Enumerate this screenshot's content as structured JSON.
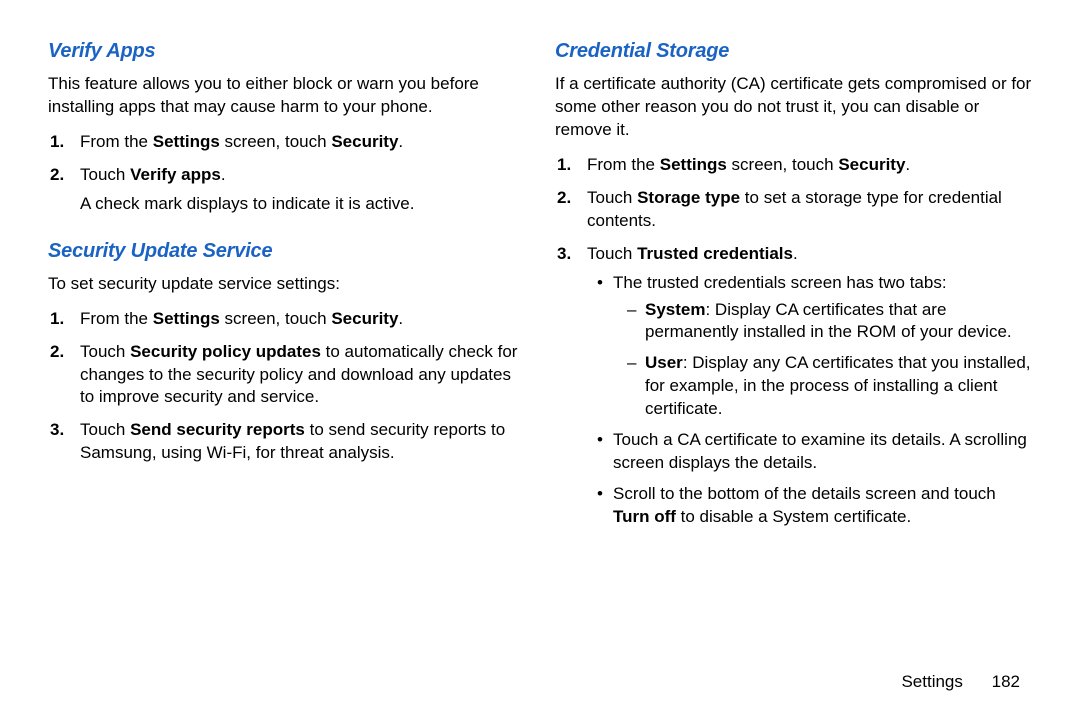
{
  "left": {
    "verify_apps": {
      "heading": "Verify Apps",
      "intro": "This feature allows you to either block or warn you before installing apps that may cause harm to your phone.",
      "step1_pre": "From the ",
      "step1_b1": "Settings",
      "step1_mid": " screen, touch ",
      "step1_b2": "Security",
      "step1_post": ".",
      "step2_pre": "Touch ",
      "step2_b1": "Verify apps",
      "step2_post": ".",
      "step2_note": "A check mark displays to indicate it is active."
    },
    "sus": {
      "heading": "Security Update Service",
      "intro": "To set security update service settings:",
      "step1_pre": "From the ",
      "step1_b1": "Settings",
      "step1_mid": " screen, touch ",
      "step1_b2": "Security",
      "step1_post": ".",
      "step2_pre": "Touch ",
      "step2_b1": "Security policy updates",
      "step2_post": " to automatically check for changes to the security policy and download any updates to improve security and service.",
      "step3_pre": "Touch ",
      "step3_b1": "Send security reports",
      "step3_post": " to send security reports to Samsung, using Wi-Fi, for threat analysis."
    }
  },
  "right": {
    "cred": {
      "heading": "Credential Storage",
      "intro": "If a certificate authority (CA) certificate gets compromised or for some other reason you do not trust it, you can disable or remove it.",
      "step1_pre": "From the ",
      "step1_b1": "Settings",
      "step1_mid": " screen, touch ",
      "step1_b2": "Security",
      "step1_post": ".",
      "step2_pre": "Touch ",
      "step2_b1": "Storage type",
      "step2_post": " to set a storage type for credential contents.",
      "step3_pre": "Touch ",
      "step3_b1": "Trusted credentials",
      "step3_post": ".",
      "bul1": "The trusted credentials screen has two tabs:",
      "dash1_b": "System",
      "dash1_post": ": Display CA certificates that are permanently installed in the ROM of your device.",
      "dash2_b": "User",
      "dash2_post": ": Display any CA certificates that you installed, for example, in the process of installing a client certificate.",
      "bul2": "Touch a CA certificate to examine its details. A scrolling screen displays the details.",
      "bul3_pre": "Scroll to the bottom of the details screen and touch ",
      "bul3_b": "Turn off",
      "bul3_post": " to disable a System certificate."
    }
  },
  "footer": {
    "label": "Settings",
    "page": "182"
  }
}
